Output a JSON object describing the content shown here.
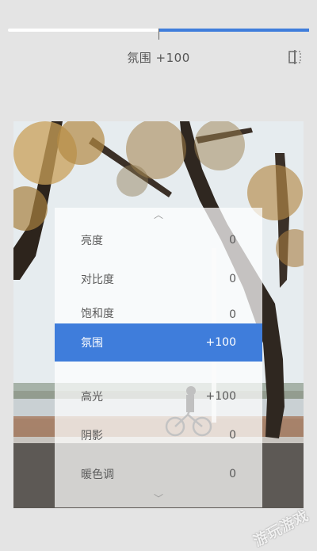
{
  "slider": {
    "value": 100,
    "min": -100,
    "max": 100
  },
  "header": {
    "label": "氛围 +100"
  },
  "menu": {
    "items": [
      {
        "name": "亮度",
        "value": "0"
      },
      {
        "name": "对比度",
        "value": "0"
      },
      {
        "name": "饱和度",
        "value": "0"
      },
      {
        "name": "氛围",
        "value": "+100",
        "active": true
      },
      {
        "name": "高光",
        "value": "+100"
      },
      {
        "name": "阴影",
        "value": "0"
      },
      {
        "name": "暖色调",
        "value": "0"
      }
    ]
  },
  "watermark": "游玩游戏",
  "colors": {
    "accent": "#3f7ddb",
    "background": "#e4e4e4"
  }
}
